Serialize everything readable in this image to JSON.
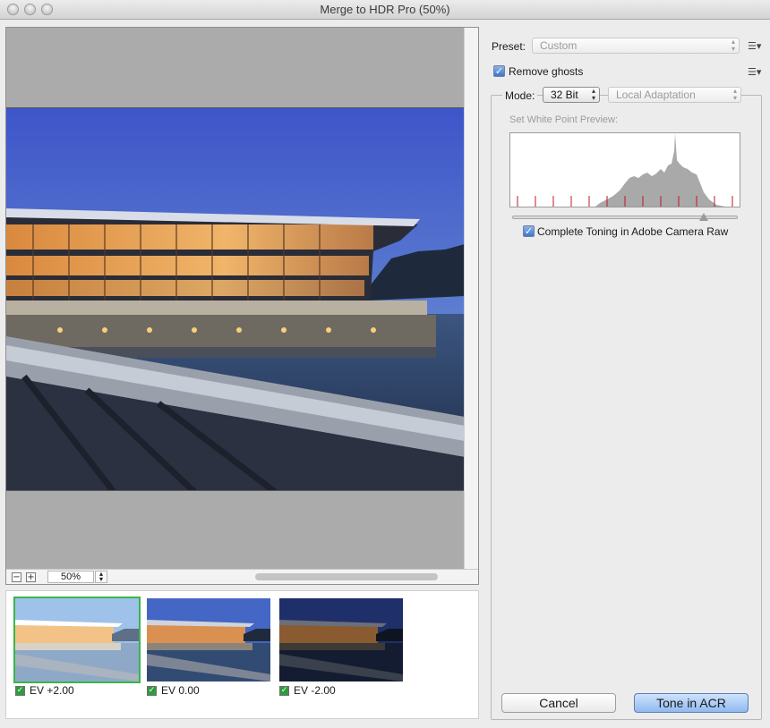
{
  "window": {
    "title": "Merge to HDR Pro (50%)"
  },
  "preview": {
    "zoom": "50%",
    "zoom_out_icon": "minus-icon",
    "zoom_in_icon": "plus-icon"
  },
  "filmstrip": {
    "items": [
      {
        "label": "EV +2.00",
        "checked": true,
        "selected": true
      },
      {
        "label": "EV 0.00",
        "checked": true,
        "selected": false
      },
      {
        "label": "EV -2.00",
        "checked": true,
        "selected": false
      }
    ]
  },
  "panel": {
    "preset_label": "Preset:",
    "preset_value": "Custom",
    "remove_ghosts_label": "Remove ghosts",
    "remove_ghosts_checked": true,
    "mode_label": "Mode:",
    "mode_value": "32 Bit",
    "method_value": "Local Adaptation",
    "white_point_label": "Set White Point Preview:",
    "complete_toning_label": "Complete Toning in Adobe Camera Raw",
    "complete_toning_checked": true,
    "white_point_level": 0.85
  },
  "buttons": {
    "cancel": "Cancel",
    "tone": "Tone in ACR"
  },
  "colors": {
    "accent_green": "#3ab54a",
    "primary_blue": "#8fbaf0"
  }
}
